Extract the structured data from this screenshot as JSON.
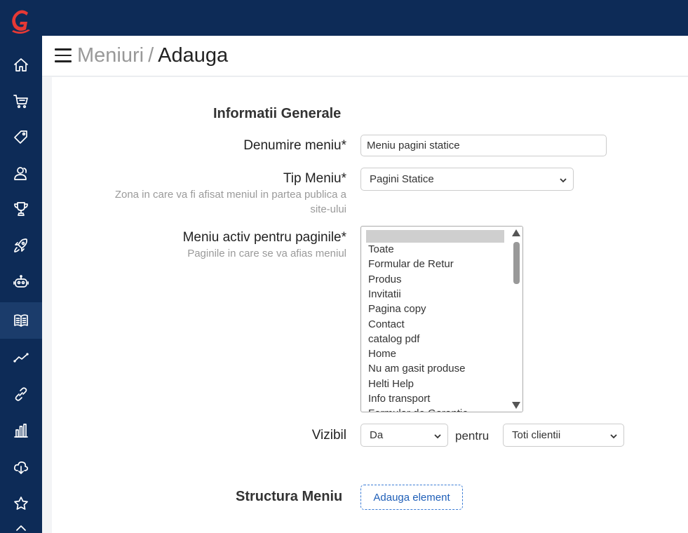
{
  "sidebar": {
    "items": [
      {
        "icon": "home-icon"
      },
      {
        "icon": "cart-icon"
      },
      {
        "icon": "tag-icon"
      },
      {
        "icon": "users-icon"
      },
      {
        "icon": "trophy-icon"
      },
      {
        "icon": "rocket-icon"
      },
      {
        "icon": "robot-icon"
      },
      {
        "icon": "book-icon",
        "active": true
      },
      {
        "icon": "chart-line-icon"
      },
      {
        "icon": "link-icon"
      },
      {
        "icon": "bar-chart-icon"
      },
      {
        "icon": "cloud-download-icon"
      },
      {
        "icon": "star-icon"
      }
    ],
    "bg_color": "#0d2b57",
    "active_color": "#1b3c6b",
    "logo_color": "#e53935"
  },
  "header": {
    "breadcrumb_parent": "Meniuri",
    "breadcrumb_separator": "/",
    "breadcrumb_current": "Adauga"
  },
  "form": {
    "section_title": "Informatii Generale",
    "name_label": "Denumire meniu*",
    "name_value": "Meniu pagini statice",
    "type_label": "Tip Meniu*",
    "type_help": "Zona in care va fi afisat meniul in partea publica a site-ului",
    "type_value": "Pagini Statice",
    "pages_label": "Meniu activ pentru paginile*",
    "pages_help": "Paginile in care se va afias meniul",
    "pages_options": [
      "Toate",
      "Formular de Retur",
      "Produs",
      "Invitatii",
      "Pagina copy",
      "Contact",
      "catalog pdf",
      "Home",
      "Nu am gasit produse",
      "Helti Help",
      "Info transport",
      "Formular de Garantie"
    ],
    "visible_label": "Vizibil",
    "visible_value": "Da",
    "for_label": "pentru",
    "for_value": "Toti clientii",
    "structure_title": "Structura Meniu",
    "add_element_label": "Adauga element",
    "accent_color": "#3a7bd5"
  }
}
